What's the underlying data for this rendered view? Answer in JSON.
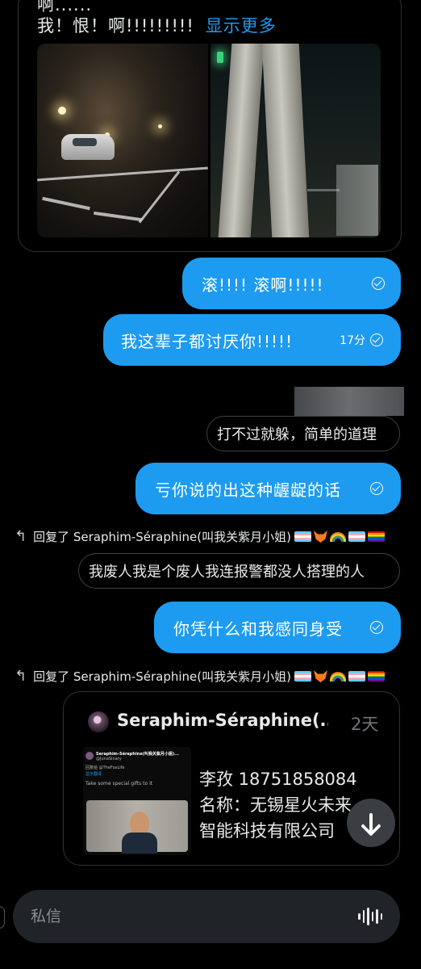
{
  "top_message": {
    "line1": "啊......",
    "line2": "我！恨！啊!!!!!!!!!",
    "show_more": "显示更多"
  },
  "outgoing": [
    {
      "text": "滚!!!!  滚啊!!!!!",
      "time": ""
    },
    {
      "text": "我这辈子都讨厌你!!!!!",
      "time": "17分"
    },
    {
      "text": "亏你说的出这种龌龊的话",
      "time": ""
    },
    {
      "text": "你凭什么和我感同身受",
      "time": ""
    }
  ],
  "incoming": [
    {
      "text": "打不过就躲，简单的道理"
    },
    {
      "text": "我废人我是个废人我连报警都没人搭理的人"
    }
  ],
  "reply_context": {
    "prefix": "回复了",
    "user": "Seraphim-Séraphine(叫我关紫月小姐)"
  },
  "quote": {
    "name": "Seraphim-Séraphine(...",
    "time": "2天",
    "lines": [
      "李孜 18751858084",
      "名称：无锡星火未来",
      "智能科技有限公司"
    ],
    "thumb": {
      "name": "Seraphim-Séraphine(叫我关紫月小姐)...",
      "handle": "@JunaSinary",
      "reply": "回复给 @TheFoxLife",
      "translate": "显示翻译",
      "caption": "Take some special gifts to it"
    }
  },
  "composer": {
    "placeholder": "私信"
  },
  "icons": [
    "reply-arrow-icon",
    "read-check-icon",
    "arrow-down-icon",
    "voice-wave-icon"
  ],
  "colors": {
    "accent": "#1d9bf0",
    "background": "#000000",
    "composer_bg": "#202327"
  }
}
